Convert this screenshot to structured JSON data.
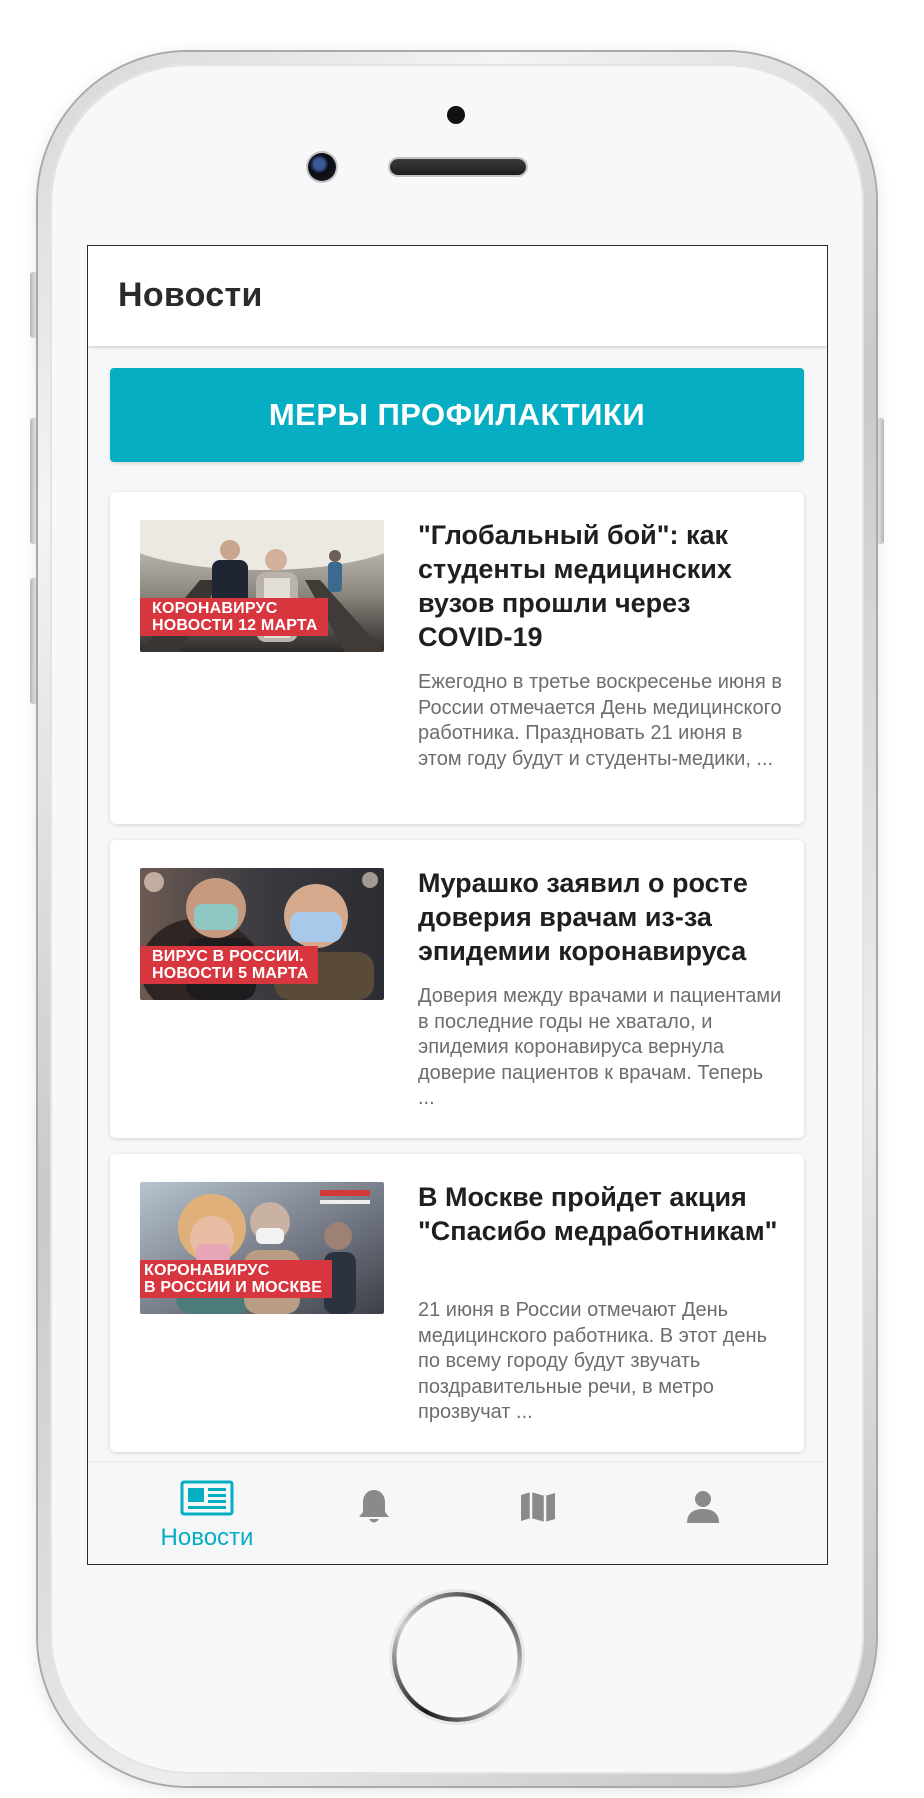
{
  "header": {
    "title": "Новости"
  },
  "prevention_button": {
    "label": "МЕРЫ ПРОФИЛАКТИКИ",
    "color": "#06aec4"
  },
  "news": [
    {
      "thumbnail_label_lines": [
        "КОРОНАВИРУС",
        "НОВОСТИ 12 МАРТА"
      ],
      "title": "\"Глобальный бой\": как студенты медицинских вузов прошли через COVID-19",
      "excerpt": "Ежегодно в третье воскресенье июня в России отмечается День медицинского работника. Праздновать 21 июня в этом году будут и студенты-медики, ..."
    },
    {
      "thumbnail_label_lines": [
        "ВИРУС В РОССИИ.",
        "НОВОСТИ 5 МАРТА"
      ],
      "title": "Мурашко заявил о росте доверия врачам из-за эпидемии коронавируса",
      "excerpt": "Доверия между врачами и пациентами в последние годы не хватало, и эпидемия коронавируса вернула доверие пациентов к врачам. Теперь ..."
    },
    {
      "thumbnail_label_lines": [
        "КОРОНАВИРУС",
        "В РОССИИ И МОСКВЕ"
      ],
      "title": "В Москве пройдет акция \"Спасибо медработникам\"",
      "excerpt": "21 июня в России отмечают День медицинского работника. В этот день по всему городу будут звучать поздравительные речи, в метро прозвучат ..."
    }
  ],
  "tabbar": {
    "active_color": "#06aec4",
    "inactive_color": "#8a8a8a",
    "tabs": [
      {
        "label": "Новости",
        "icon": "newspaper-icon",
        "active": true
      },
      {
        "icon": "bell-icon",
        "active": false
      },
      {
        "icon": "map-icon",
        "active": false
      },
      {
        "icon": "user-icon",
        "active": false
      }
    ]
  }
}
